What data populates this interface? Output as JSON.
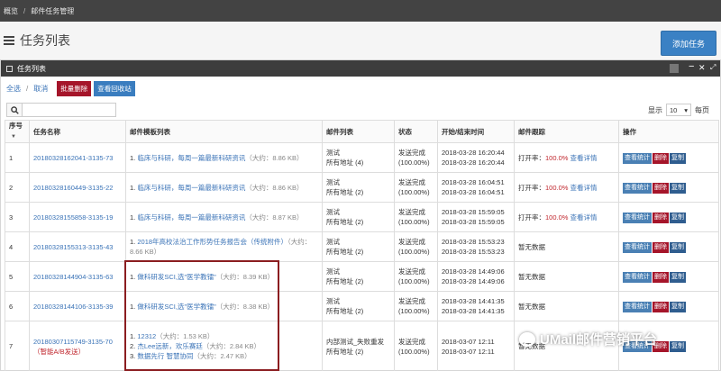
{
  "breadcrumb": {
    "home": "概览",
    "separator": "/",
    "current": "邮件任务管理"
  },
  "page": {
    "title": "任务列表",
    "add_button": "添加任务"
  },
  "panel": {
    "title": "任务列表",
    "controls": {
      "minimize": "−",
      "close": "✕",
      "expand": "⤢"
    }
  },
  "toolbar": {
    "select_all": "全选",
    "separator": "/",
    "cancel": "取消",
    "batch_delete": "批量删除",
    "recycle_bin": "查看回收站"
  },
  "search": {
    "placeholder": ""
  },
  "paging": {
    "show_label": "显示",
    "page_size": "10",
    "per_page": "每页"
  },
  "columns": [
    "序号",
    "任务名称",
    "邮件模板列表",
    "邮件列表",
    "状态",
    "开始/结束时间",
    "邮件跟踪",
    "操作"
  ],
  "rows": [
    {
      "index": "1",
      "name": "20180328162041-3135-73",
      "templates": [
        {
          "no": "1.",
          "title": "临床与科研，每周一篇最新科研资讯",
          "size": "（大约：8.86 KB）"
        }
      ],
      "list_name": "测试",
      "list_count": "所有地址 (4)",
      "status": "发送完成",
      "status_pct": "(100.00%)",
      "start": "2018-03-28 16:20:44",
      "end": "2018-03-28 16:20:44",
      "track_label": "打开率：",
      "track_rate": "100.0%",
      "track_link": "查看详情"
    },
    {
      "index": "2",
      "name": "20180328160449-3135-22",
      "templates": [
        {
          "no": "1.",
          "title": "临床与科研，每周一篇最新科研资讯",
          "size": "（大约：8.86 KB）"
        }
      ],
      "list_name": "测试",
      "list_count": "所有地址 (2)",
      "status": "发送完成",
      "status_pct": "(100.00%)",
      "start": "2018-03-28 16:04:51",
      "end": "2018-03-28 16:04:51",
      "track_label": "打开率：",
      "track_rate": "100.0%",
      "track_link": "查看详情"
    },
    {
      "index": "3",
      "name": "20180328155858-3135-19",
      "templates": [
        {
          "no": "1.",
          "title": "临床与科研，每周一篇最新科研资讯",
          "size": "（大约：8.87 KB）"
        }
      ],
      "list_name": "测试",
      "list_count": "所有地址 (2)",
      "status": "发送完成",
      "status_pct": "(100.00%)",
      "start": "2018-03-28 15:59:05",
      "end": "2018-03-28 15:59:05",
      "track_label": "打开率：",
      "track_rate": "100.0%",
      "track_link": "查看详情"
    },
    {
      "index": "4",
      "name": "20180328155313-3135-43",
      "templates": [
        {
          "no": "1.",
          "title": "2018年高校法治工作形势任务报告会（传统附件）",
          "size": "（大约：8.66 KB）"
        }
      ],
      "list_name": "测试",
      "list_count": "所有地址 (2)",
      "status": "发送完成",
      "status_pct": "(100.00%)",
      "start": "2018-03-28 15:53:23",
      "end": "2018-03-28 15:53:23",
      "track_label": "暂无数据",
      "track_rate": "",
      "track_link": ""
    },
    {
      "index": "5",
      "name": "20180328144904-3135-63",
      "templates": [
        {
          "no": "1.",
          "title": "做科研发SCI,选\"医学教镭\"",
          "size": "（大约：8.39 KB）"
        }
      ],
      "list_name": "测试",
      "list_count": "所有地址 (2)",
      "status": "发送完成",
      "status_pct": "(100.00%)",
      "start": "2018-03-28 14:49:06",
      "end": "2018-03-28 14:49:06",
      "track_label": "暂无数据",
      "track_rate": "",
      "track_link": ""
    },
    {
      "index": "6",
      "name": "20180328144106-3135-39",
      "templates": [
        {
          "no": "1.",
          "title": "做科研发SCI,选\"医学教镭\"",
          "size": "（大约：8.38 KB）"
        }
      ],
      "list_name": "测试",
      "list_count": "所有地址 (2)",
      "status": "发送完成",
      "status_pct": "(100.00%)",
      "start": "2018-03-28 14:41:35",
      "end": "2018-03-28 14:41:35",
      "track_label": "暂无数据",
      "track_rate": "",
      "track_link": ""
    },
    {
      "index": "7",
      "name": "20180307115749-3135-70",
      "tag": "（智能A/B发送）",
      "templates": [
        {
          "no": "1.",
          "title": "12312",
          "size": "（大约：1.53 KB）"
        },
        {
          "no": "2.",
          "title": "杰Lee远新，欢乐赛廷",
          "size": "（大约：2.84 KB）"
        },
        {
          "no": "3.",
          "title": "数据先行 智慧协同",
          "size": "（大约：2.47 KB）"
        }
      ],
      "list_name": "内部测试_失败重发",
      "list_count": "所有地址 (2)",
      "status": "发送完成",
      "status_pct": "(100.00%)",
      "start": "2018-03-07 12:11",
      "end": "2018-03-07 12:11",
      "track_label": "暂无数据",
      "track_rate": "",
      "track_link": ""
    }
  ],
  "row_actions": {
    "stats": "查看统计",
    "delete": "删除",
    "copy": "复制"
  },
  "watermark": "UMail邮件营销平台"
}
